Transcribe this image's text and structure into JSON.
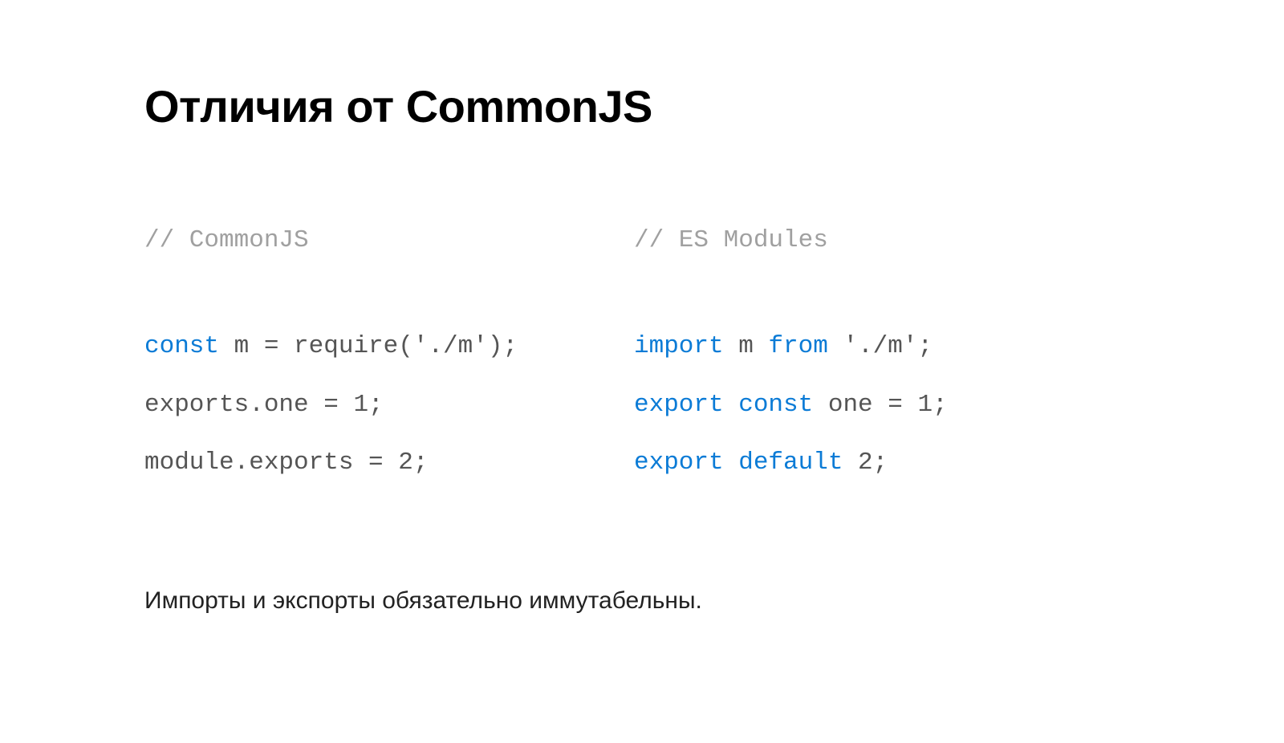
{
  "title": "Отличия от CommonJS",
  "left": {
    "comment": "// CommonJS",
    "line1_a": "const",
    "line1_b": " m = require('./m');",
    "line2": "exports.one = 1;",
    "line3": "module.exports = 2;"
  },
  "right": {
    "comment": "// ES Modules",
    "line1_a": "import",
    "line1_b": " m ",
    "line1_c": "from",
    "line1_d": " './m';",
    "line2_a": "export const",
    "line2_b": " one = 1;",
    "line3_a": "export default",
    "line3_b": " 2;"
  },
  "footnote": "Импорты и экспорты обязательно иммутабельны."
}
